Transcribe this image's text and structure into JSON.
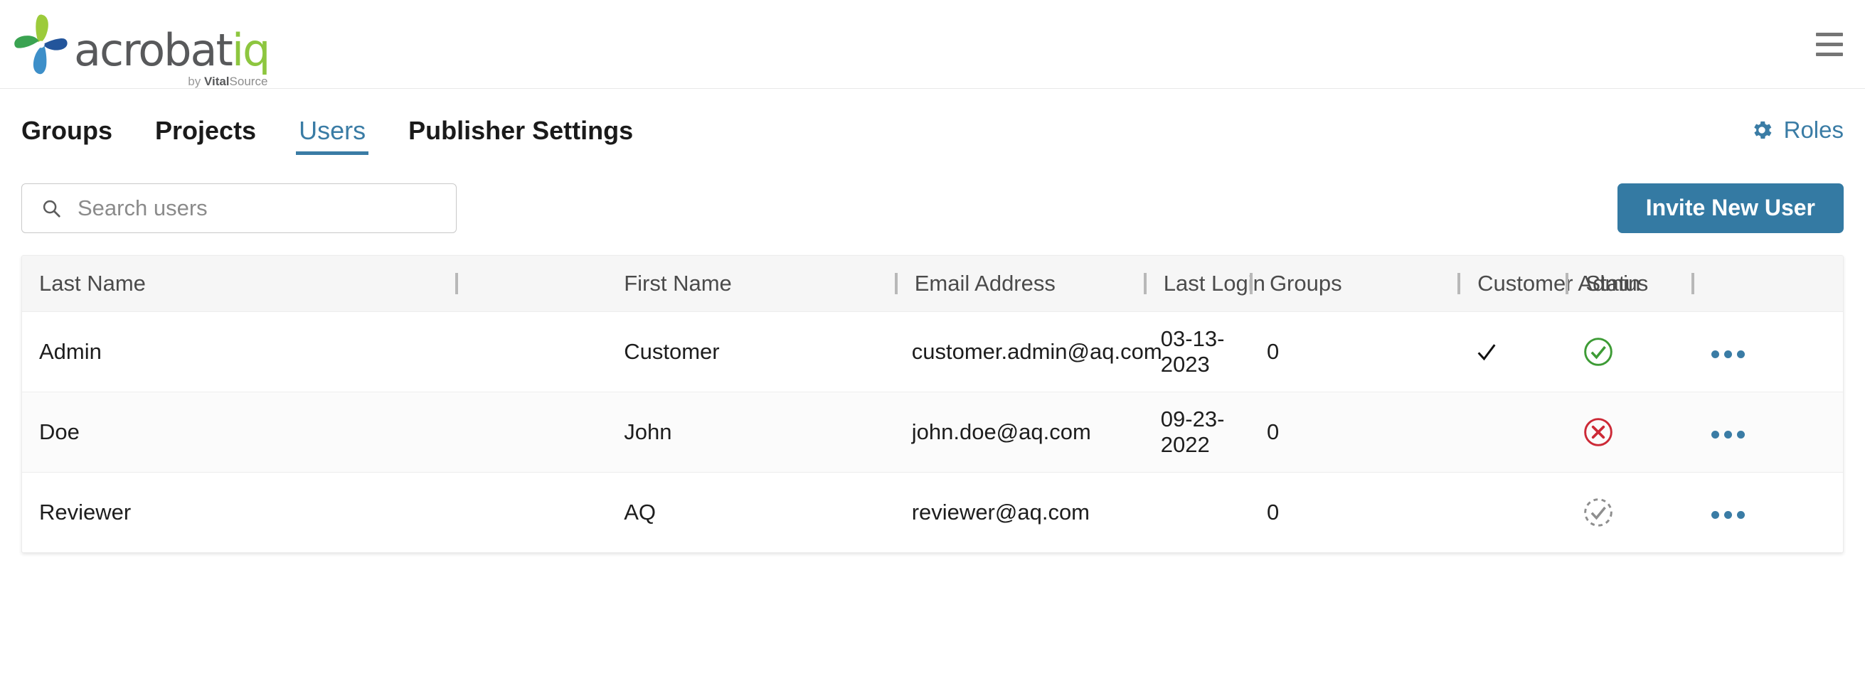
{
  "brand": {
    "logo_word_dark": "acrobat",
    "logo_word_green": "iq",
    "sub_by": "by ",
    "sub_vital": "Vital",
    "sub_source": "Source",
    "menu_icon": "hamburger-menu-icon"
  },
  "nav": {
    "tabs": [
      {
        "label": "Groups",
        "active": false
      },
      {
        "label": "Projects",
        "active": false
      },
      {
        "label": "Users",
        "active": true
      },
      {
        "label": "Publisher Settings",
        "active": false
      }
    ],
    "roles_label": "Roles",
    "roles_icon": "gear-icon",
    "accent_color": "#3a7ca5"
  },
  "toolbar": {
    "search_placeholder": "Search users",
    "search_value": "",
    "search_icon": "search-icon",
    "invite_label": "Invite New User",
    "invite_color": "#347aa3"
  },
  "table": {
    "columns": [
      "Last Name",
      "First Name",
      "Email Address",
      "Last Login",
      "Groups",
      "Customer Admin",
      "Status"
    ],
    "rows": [
      {
        "last_name": "Admin",
        "first_name": "Customer",
        "email": "customer.admin@aq.com",
        "last_login": "03-13-2023",
        "groups": "0",
        "customer_admin": "check",
        "status": "active",
        "actions": "row-actions-menu"
      },
      {
        "last_name": "Doe",
        "first_name": "John",
        "email": "john.doe@aq.com",
        "last_login": "09-23-2022",
        "groups": "0",
        "customer_admin": "",
        "status": "disabled",
        "actions": "row-actions-menu"
      },
      {
        "last_name": "Reviewer",
        "first_name": "AQ",
        "email": "reviewer@aq.com",
        "last_login": "",
        "groups": "0",
        "customer_admin": "",
        "status": "pending",
        "actions": "row-actions-menu"
      }
    ],
    "status_colors": {
      "active": "#3d9b35",
      "disabled": "#cc2936",
      "pending": "#8e8e8e"
    }
  }
}
